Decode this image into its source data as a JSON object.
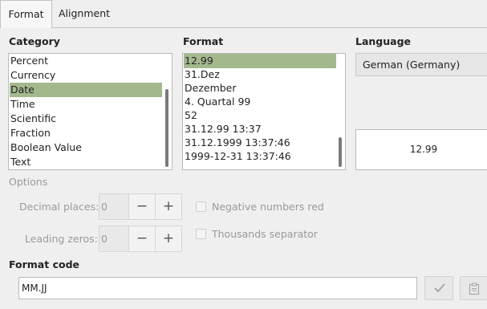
{
  "tabs": [
    {
      "label": "Format",
      "active": true
    },
    {
      "label": "Alignment",
      "active": false
    }
  ],
  "category": {
    "heading": "Category",
    "items": [
      "Percent",
      "Currency",
      "Date",
      "Time",
      "Scientific",
      "Fraction",
      "Boolean Value",
      "Text"
    ],
    "selected": "Date"
  },
  "format": {
    "heading": "Format",
    "items": [
      "12.99",
      "31.Dez",
      "Dezember",
      "4. Quartal 99",
      "52",
      "31.12.99 13:37",
      "31.12.1999 13:37:46",
      "1999-12-31 13:37:46"
    ],
    "selected": "12.99"
  },
  "language": {
    "heading": "Language",
    "value": "German (Germany)"
  },
  "preview": {
    "value": "12.99"
  },
  "options": {
    "heading": "Options",
    "decimal_places_label": "Decimal places:",
    "decimal_places_value": "0",
    "leading_zeros_label": "Leading zeros:",
    "leading_zeros_value": "0",
    "minus_glyph": "−",
    "plus_glyph": "+",
    "negative_red_label": "Negative numbers red",
    "thousands_sep_label": "Thousands separator"
  },
  "format_code": {
    "heading": "Format code",
    "value": "MM.JJ"
  },
  "icons": {
    "accept": "checkmark-icon",
    "edit_comment": "clipboard-icon"
  },
  "colors": {
    "selection": "#a4b88e",
    "background": "#efefef"
  }
}
